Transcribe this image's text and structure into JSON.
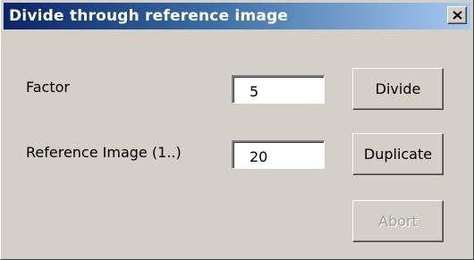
{
  "window": {
    "title": "Divide through reference image"
  },
  "fields": {
    "factor_label": "Factor",
    "factor_value": "5",
    "reference_label": "Reference Image (1..)",
    "reference_value": "20"
  },
  "buttons": {
    "divide": "Divide",
    "duplicate": "Duplicate",
    "abort": "Abort"
  },
  "icons": {
    "close": "close-icon"
  },
  "colors": {
    "titlebar_start": "#0a246a",
    "titlebar_end": "#a6caf0",
    "dialog_bg": "#d4d0c8"
  }
}
